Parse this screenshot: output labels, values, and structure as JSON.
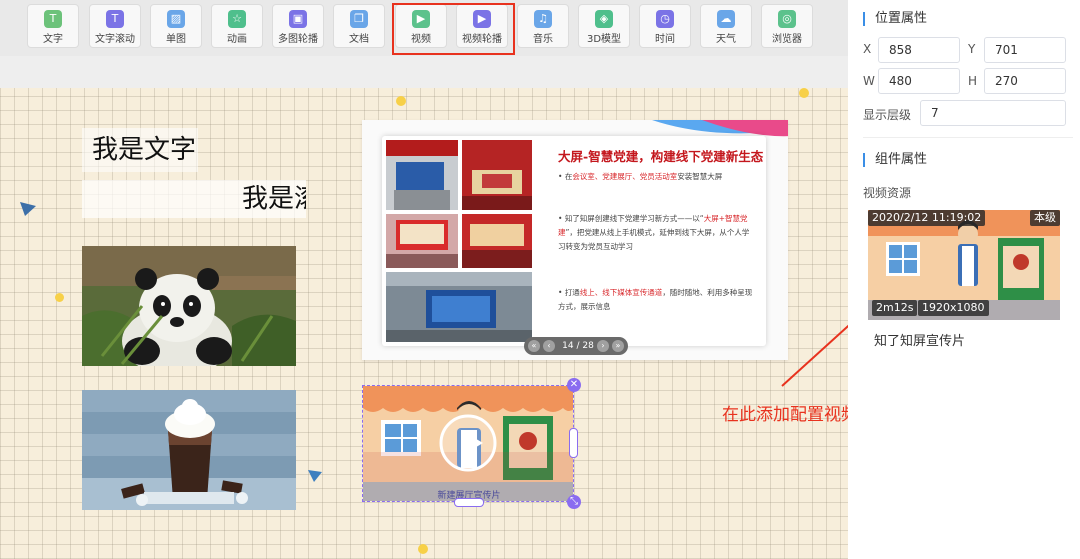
{
  "toolbar": {
    "items": [
      {
        "label": "文字",
        "icon": "T",
        "icon_name": "text-icon",
        "color": "#6cc27a"
      },
      {
        "label": "文字滚动",
        "icon": "T",
        "icon_name": "scroll-text-icon",
        "color": "#7b73e6"
      },
      {
        "label": "单图",
        "icon": "▨",
        "icon_name": "image-icon",
        "color": "#6aa6e8"
      },
      {
        "label": "动画",
        "icon": "☆",
        "icon_name": "animation-icon",
        "color": "#4fbf8c"
      },
      {
        "label": "多图轮播",
        "icon": "▣",
        "icon_name": "image-carousel-icon",
        "color": "#7b73e6"
      },
      {
        "label": "文档",
        "icon": "❐",
        "icon_name": "document-icon",
        "color": "#6aa6e8"
      },
      {
        "label": "视频",
        "icon": "▶",
        "icon_name": "video-icon",
        "color": "#5cc28c"
      },
      {
        "label": "视频轮播",
        "icon": "▶",
        "icon_name": "video-carousel-icon",
        "color": "#7b73e6"
      },
      {
        "label": "音乐",
        "icon": "♫",
        "icon_name": "music-icon",
        "color": "#6aa6e8"
      },
      {
        "label": "3D模型",
        "icon": "◈",
        "icon_name": "3d-model-icon",
        "color": "#4fbf8c"
      },
      {
        "label": "时间",
        "icon": "◷",
        "icon_name": "time-icon",
        "color": "#7b73e6"
      },
      {
        "label": "天气",
        "icon": "☁",
        "icon_name": "weather-icon",
        "color": "#6aa6e8"
      },
      {
        "label": "浏览器",
        "icon": "◎",
        "icon_name": "browser-icon",
        "color": "#5cc28c"
      }
    ]
  },
  "canvas": {
    "text1": "我是文字",
    "text2": "我是滚动文字",
    "slide": {
      "title": "大屏-智慧党建，构建线下党建新生态",
      "bullet1_parts": [
        "在",
        "会议室、党建展厅、党员活动室",
        "安装智慧大屏"
      ],
      "bullet2_parts": [
        "知了知屏创建线下党建学习新方式——以“",
        "大屏+智慧党建",
        "”，把党建从线上手机模式，延伸到线下大屏，从个人学习转变为党员互动学习"
      ],
      "bullet3_parts": [
        "打通",
        "线上、线下媒体宣传通道",
        "，随时随地、利用多种呈现方式，展示信息"
      ],
      "page": "14 / 28"
    },
    "video_caption": "新建展厅宣传片"
  },
  "panel": {
    "position_title": "位置属性",
    "x_label": "X",
    "x_value": "858",
    "y_label": "Y",
    "y_value": "701",
    "w_label": "W",
    "w_value": "480",
    "h_label": "H",
    "h_value": "270",
    "layer_label": "显示层级",
    "layer_value": "7",
    "component_title": "组件属性",
    "video_source_label": "视频资源",
    "video": {
      "date": "2020/2/12 11:19:02",
      "tag": "本级",
      "duration": "2m12s",
      "resolution": "1920x1080",
      "name": "知了知屏宣传片"
    }
  },
  "annotation": "在此添加配置视频",
  "colors": {
    "highlight": "#e8321e",
    "accent": "#3a8ee6",
    "selection": "#8a6cf0",
    "slide_red": "#c4171d"
  }
}
